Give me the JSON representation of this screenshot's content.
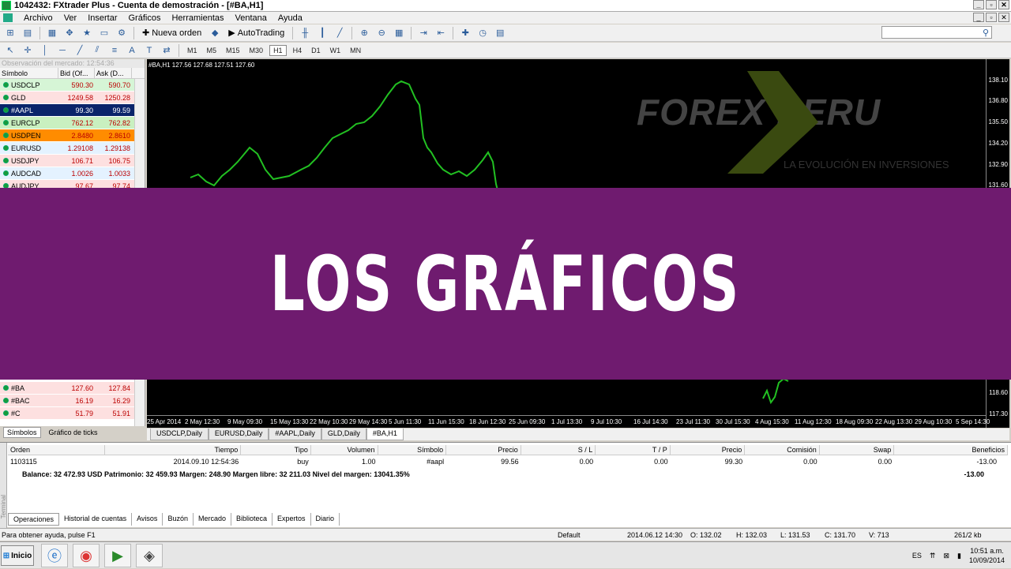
{
  "window": {
    "title": "1042432: FXtrader Plus - Cuenta de demostración - [#BA,H1]"
  },
  "menu": [
    "Archivo",
    "Ver",
    "Insertar",
    "Gráficos",
    "Herramientas",
    "Ventana",
    "Ayuda"
  ],
  "toolbar": {
    "new_order": "Nueva orden",
    "autotrading": "AutoTrading"
  },
  "timeframes": [
    "M1",
    "M5",
    "M15",
    "M30",
    "H1",
    "H4",
    "D1",
    "W1",
    "MN"
  ],
  "active_timeframe": "H1",
  "market_watch": {
    "title": "Observación del mercado: 12:54:36",
    "headers": [
      "Símbolo",
      "Bid (Of...",
      "Ask (D..."
    ],
    "rows_top": [
      {
        "symbol": "USDCLP",
        "bid": "590.30",
        "ask": "590.70",
        "color": "#d6f5d6"
      },
      {
        "symbol": "GLD",
        "bid": "1249.58",
        "ask": "1250.28",
        "color": "#fde0e0"
      },
      {
        "symbol": "#AAPL",
        "bid": "99.30",
        "ask": "99.59",
        "color": "#0a246a"
      },
      {
        "symbol": "EURCLP",
        "bid": "762.12",
        "ask": "762.82",
        "color": "#c9f0c0"
      },
      {
        "symbol": "USDPEN",
        "bid": "2.8480",
        "ask": "2.8610",
        "color": "#ff8c00"
      },
      {
        "symbol": "EURUSD",
        "bid": "1.29108",
        "ask": "1.29138",
        "color": "#e4f2ff"
      },
      {
        "symbol": "USDJPY",
        "bid": "106.71",
        "ask": "106.75",
        "color": "#fde0e0"
      },
      {
        "symbol": "AUDCAD",
        "bid": "1.0026",
        "ask": "1.0033",
        "color": "#e4f2ff"
      },
      {
        "symbol": "AUDJPY",
        "bid": "97.67",
        "ask": "97.74",
        "color": "#fde0e0"
      }
    ],
    "rows_bottom": [
      {
        "symbol": "#BA",
        "bid": "127.60",
        "ask": "127.84",
        "color": "#fde0e0"
      },
      {
        "symbol": "#BAC",
        "bid": "16.19",
        "ask": "16.29",
        "color": "#fde0e0"
      },
      {
        "symbol": "#C",
        "bid": "51.79",
        "ask": "51.91",
        "color": "#fde0e0"
      }
    ],
    "tabs": [
      "Símbolos",
      "Gráfico de ticks"
    ]
  },
  "chart": {
    "label": "#BA,H1  127.56 127.68 127.51 127.60",
    "price_ticks": [
      "138.10",
      "136.80",
      "135.50",
      "134.20",
      "132.90",
      "131.60",
      "118.60",
      "117.30"
    ],
    "time_ticks": [
      "25 Apr 2014",
      "2 May 12:30",
      "9 May 09:30",
      "15 May 13:30",
      "22 May 10:30",
      "29 May 14:30",
      "5 Jun 11:30",
      "11 Jun 15:30",
      "18 Jun 12:30",
      "25 Jun 09:30",
      "1 Jul 13:30",
      "9 Jul 10:30",
      "16 Jul 14:30",
      "23 Jul 11:30",
      "30 Jul 15:30",
      "4 Aug 15:30",
      "11 Aug 12:30",
      "18 Aug 09:30",
      "22 Aug 13:30",
      "29 Aug 10:30",
      "5 Sep 14:30"
    ],
    "watermark": "FOREX PERU",
    "watermark_sub": "LA EVOLUCIÓN EN INVERSIONES"
  },
  "chart_tabs": [
    "USDCLP,Daily",
    "EURUSD,Daily",
    "#AAPL,Daily",
    "GLD,Daily",
    "#BA,H1"
  ],
  "terminal": {
    "headers": [
      "Orden",
      "Tiempo",
      "Tipo",
      "Volumen",
      "Símbolo",
      "Precio",
      "S / L",
      "T / P",
      "Precio",
      "Comisión",
      "Swap",
      "Beneficios"
    ],
    "row": [
      "1103115",
      "2014.09.10 12:54:36",
      "buy",
      "1.00",
      "#aapl",
      "99.56",
      "0.00",
      "0.00",
      "99.30",
      "0.00",
      "0.00",
      "-13.00"
    ],
    "balance": "Balance: 32 472.93 USD  Patrimonio: 32 459.93  Margen: 248.90  Margen libre: 32 211.03  Nivel del margen: 13041.35%",
    "balance_profit": "-13.00",
    "tabs": [
      "Operaciones",
      "Historial de cuentas",
      "Avisos",
      "Buzón",
      "Mercado",
      "Biblioteca",
      "Expertos",
      "Diario"
    ],
    "side_label": "Terminal"
  },
  "status": {
    "help": "Para obtener ayuda, pulse F1",
    "profile": "Default",
    "date": "2014.06.12 14:30",
    "open": "O: 132.02",
    "high": "H: 132.03",
    "low": "L: 131.53",
    "close": "C: 131.70",
    "volume": "V: 713",
    "traffic": "261/2 kb"
  },
  "taskbar": {
    "start": "Inicio",
    "lang": "ES",
    "time": "10:51 a.m.",
    "date": "10/09/2014"
  },
  "banner": {
    "text": "LOS GRÁFICOS",
    "color": "#6f1b6f"
  }
}
